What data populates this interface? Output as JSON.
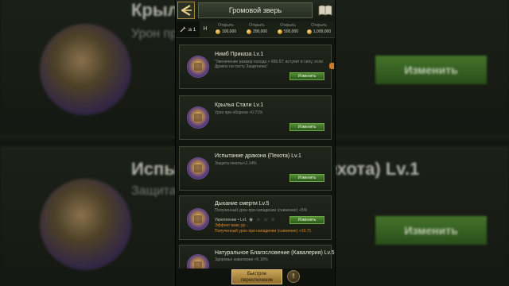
{
  "background": {
    "panel1_title": "Крылья Стали Lv.1",
    "panel1_sub": "Урон при обороне +0.71%",
    "panel2_title": "Испытание дракона (Пехота) Lv.1",
    "panel2_sub": "Защита пехоты +2.14%",
    "button": "Изменить"
  },
  "header": {
    "back_icon": "back-arrow-icon",
    "title": "Громовой зверь",
    "book_icon": "book-icon"
  },
  "resources": {
    "current_tab": ":а 1",
    "h_label": "Н",
    "items": [
      {
        "label": "Открыть",
        "value": "100,000"
      },
      {
        "label": "Открыть",
        "value": "200,000"
      },
      {
        "label": "Открыть",
        "value": "500,000"
      },
      {
        "label": "Открыть",
        "value": "1,000,000"
      }
    ]
  },
  "cards": [
    {
      "title": "Нимб Приказа Lv.1",
      "desc": "\"Увеличение размер похода + 666.67; вступит в силу, если Дракон на посту Защитника\"",
      "button": "Изменить"
    },
    {
      "title": "Крылья Стали Lv.1",
      "desc": "Урон при обороне +0.71%",
      "button": "Изменить"
    },
    {
      "title": "Испытание дракона (Пехота) Lv.1",
      "desc": "Защита пехоты+2.14%",
      "button": "Изменить"
    },
    {
      "title": "Дыхание смерти Lv.5",
      "desc": "Полученный урон при нападении (снижение) +5%",
      "upgrade_label": "Укрепление • Lv1",
      "stars_filled": 1,
      "stars_total": 4,
      "orange1": "Эффект макс.ур...",
      "orange2": "Полученный урон при нападении (снижение) +10.71",
      "button": "Изменить"
    },
    {
      "title": "Натуральное Благословение (Кавалерия) Lv.5",
      "desc": "Здоровье кавалерии +5.10%"
    }
  ],
  "bottom": {
    "quick_line1": "Быстрое",
    "quick_line2": "переключение",
    "info_label": "!"
  },
  "colors": {
    "accent_green": "#4f8c31",
    "gold": "#caa65a",
    "orange": "#e0892b"
  }
}
